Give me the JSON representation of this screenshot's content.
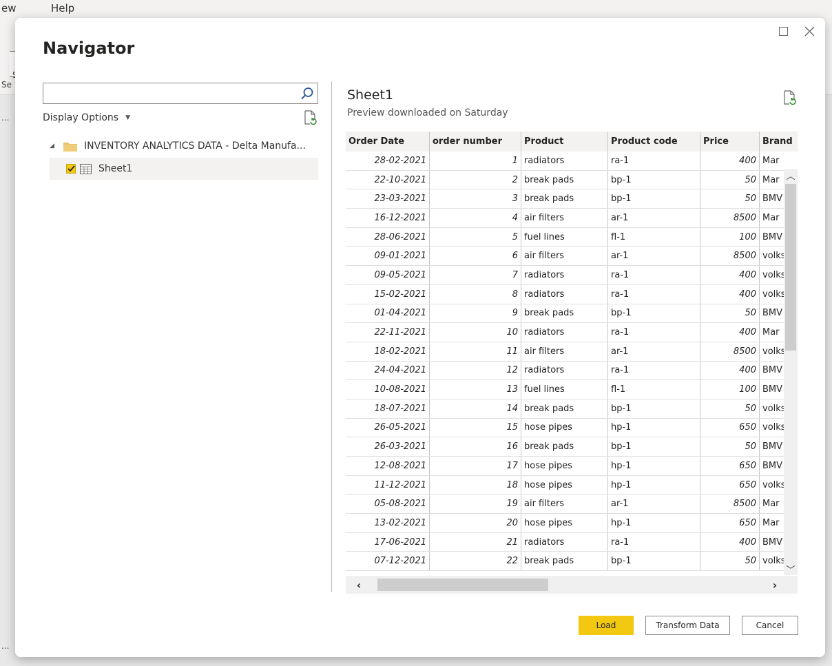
{
  "app": {
    "menu_view_partial": "ew",
    "menu_help": "Help",
    "ribbon_partial_1": "S",
    "ribbon_partial_2": "Se",
    "ellipsis": "..."
  },
  "dialog": {
    "title": "Navigator"
  },
  "search": {
    "value": "",
    "placeholder": ""
  },
  "display_options": {
    "label": "Display Options"
  },
  "tree": {
    "root": {
      "label": "INVENTORY ANALYTICS DATA - Delta Manufa...",
      "expanded": true
    },
    "children": [
      {
        "label": "Sheet1",
        "checked": true,
        "selected": true
      }
    ]
  },
  "preview": {
    "title": "Sheet1",
    "subtitle": "Preview downloaded on Saturday",
    "columns": [
      "Order Date",
      "order number",
      "Product",
      "Product code",
      "Price",
      "Brand"
    ],
    "rows": [
      [
        "28-02-2021",
        "1",
        "radiators",
        "ra-1",
        "400",
        "Mar"
      ],
      [
        "22-10-2021",
        "2",
        "break pads",
        "bp-1",
        "50",
        "Mar"
      ],
      [
        "23-03-2021",
        "3",
        "break pads",
        "bp-1",
        "50",
        "BMV"
      ],
      [
        "16-12-2021",
        "4",
        "air filters",
        "ar-1",
        "8500",
        "Mar"
      ],
      [
        "28-06-2021",
        "5",
        "fuel lines",
        "fl-1",
        "100",
        "BMV"
      ],
      [
        "09-01-2021",
        "6",
        "air filters",
        "ar-1",
        "8500",
        "volks"
      ],
      [
        "09-05-2021",
        "7",
        "radiators",
        "ra-1",
        "400",
        "volks"
      ],
      [
        "15-02-2021",
        "8",
        "radiators",
        "ra-1",
        "400",
        "volks"
      ],
      [
        "01-04-2021",
        "9",
        "break pads",
        "bp-1",
        "50",
        "BMV"
      ],
      [
        "22-11-2021",
        "10",
        "radiators",
        "ra-1",
        "400",
        "Mar"
      ],
      [
        "18-02-2021",
        "11",
        "air filters",
        "ar-1",
        "8500",
        "volks"
      ],
      [
        "24-04-2021",
        "12",
        "radiators",
        "ra-1",
        "400",
        "BMV"
      ],
      [
        "10-08-2021",
        "13",
        "fuel lines",
        "fl-1",
        "100",
        "BMV"
      ],
      [
        "18-07-2021",
        "14",
        "break pads",
        "bp-1",
        "50",
        "volks"
      ],
      [
        "26-05-2021",
        "15",
        "hose pipes",
        "hp-1",
        "650",
        "volks"
      ],
      [
        "26-03-2021",
        "16",
        "break pads",
        "bp-1",
        "50",
        "BMV"
      ],
      [
        "12-08-2021",
        "17",
        "hose pipes",
        "hp-1",
        "650",
        "BMV"
      ],
      [
        "11-12-2021",
        "18",
        "hose pipes",
        "hp-1",
        "650",
        "volks"
      ],
      [
        "05-08-2021",
        "19",
        "air filters",
        "ar-1",
        "8500",
        "Mar"
      ],
      [
        "13-02-2021",
        "20",
        "hose pipes",
        "hp-1",
        "650",
        "Mar"
      ],
      [
        "17-06-2021",
        "21",
        "radiators",
        "ra-1",
        "400",
        "BMV"
      ],
      [
        "07-12-2021",
        "22",
        "break pads",
        "bp-1",
        "50",
        "volks"
      ]
    ]
  },
  "buttons": {
    "load": "Load",
    "transform": "Transform Data",
    "cancel": "Cancel"
  },
  "icons": {
    "search": "search-icon",
    "refresh": "refresh-document-icon",
    "folder": "folder-icon",
    "table": "table-icon",
    "maximize": "maximize-icon",
    "close": "close-icon"
  },
  "colors": {
    "accent": "#f2c811",
    "folder": "#e8c069"
  }
}
